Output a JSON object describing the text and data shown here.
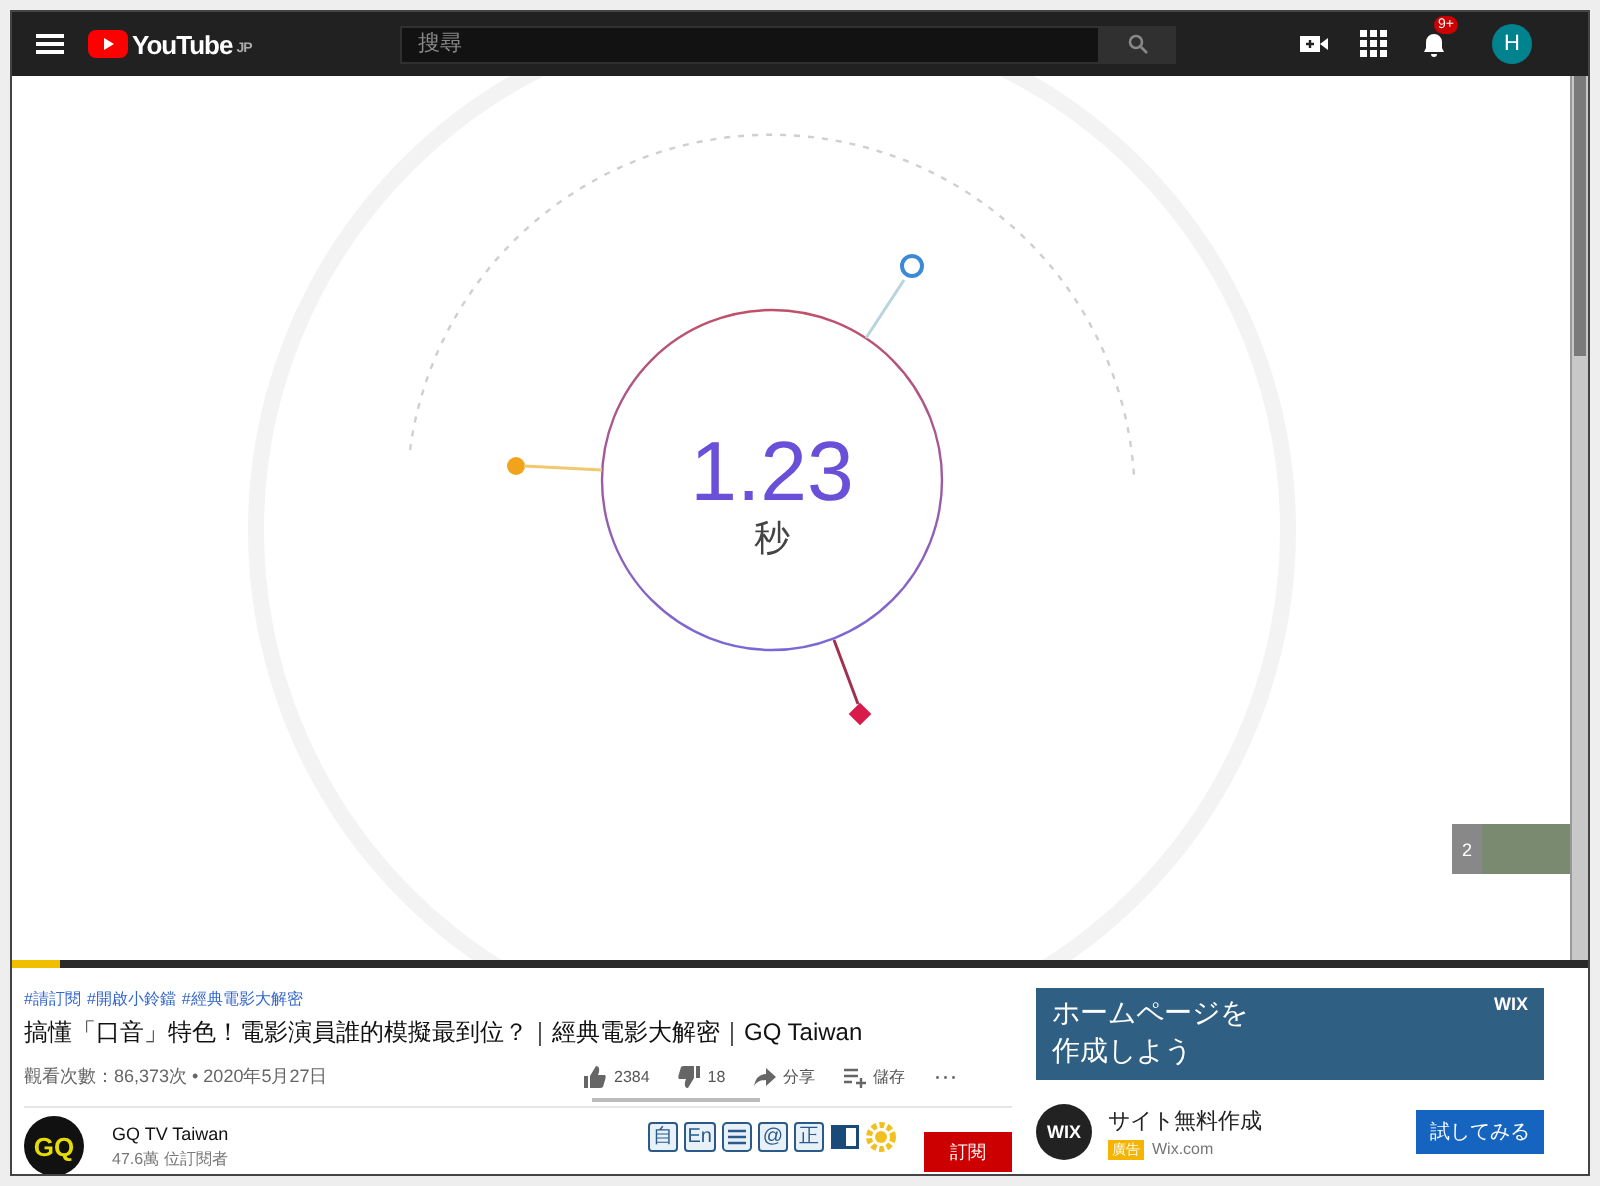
{
  "topbar": {
    "logo": "YouTube",
    "region": "JP",
    "search": {
      "placeholder": "搜尋"
    },
    "notification_badge": "9+",
    "avatar": "H"
  },
  "video": {
    "timer": {
      "value": "1.23",
      "unit": "秒"
    },
    "playlist_count": "2",
    "progress": {
      "level": 0.03
    }
  },
  "info": {
    "hashtags": [
      "#請訂閱",
      "#開啟小鈴鐺",
      "#經典電影大解密"
    ],
    "title": "搞懂「口音」特色！電影演員誰的模擬最到位？｜經典電影大解密｜GQ Taiwan",
    "views": "觀看次數：86,373次 • 2020年5月27日",
    "actions": [
      {
        "kind": "like",
        "label": "2384"
      },
      {
        "kind": "dislike",
        "label": "18"
      },
      {
        "kind": "share",
        "label": "分享"
      },
      {
        "kind": "save",
        "label": "儲存"
      },
      {
        "kind": "more",
        "label": "···"
      }
    ]
  },
  "channel": {
    "logo": "GQ",
    "name": "GQ TV Taiwan",
    "subscribers": "47.6萬 位訂閱者",
    "subscribe": "訂閱"
  },
  "extension_icons": [
    {
      "kind": "glyph",
      "label": "自"
    },
    {
      "kind": "glyph",
      "label": "En"
    },
    {
      "kind": "lines"
    },
    {
      "kind": "glyph",
      "label": "@"
    },
    {
      "kind": "glyph",
      "label": "正"
    },
    {
      "kind": "book"
    },
    {
      "kind": "gear"
    }
  ],
  "ad": {
    "banner_lines": [
      "ホームページを",
      "作成しよう"
    ],
    "banner_brand": "WIX",
    "brand": "WIX",
    "title": "サイト無料作成",
    "badge": "廣告",
    "domain": "Wix.com",
    "button": "試してみる"
  }
}
